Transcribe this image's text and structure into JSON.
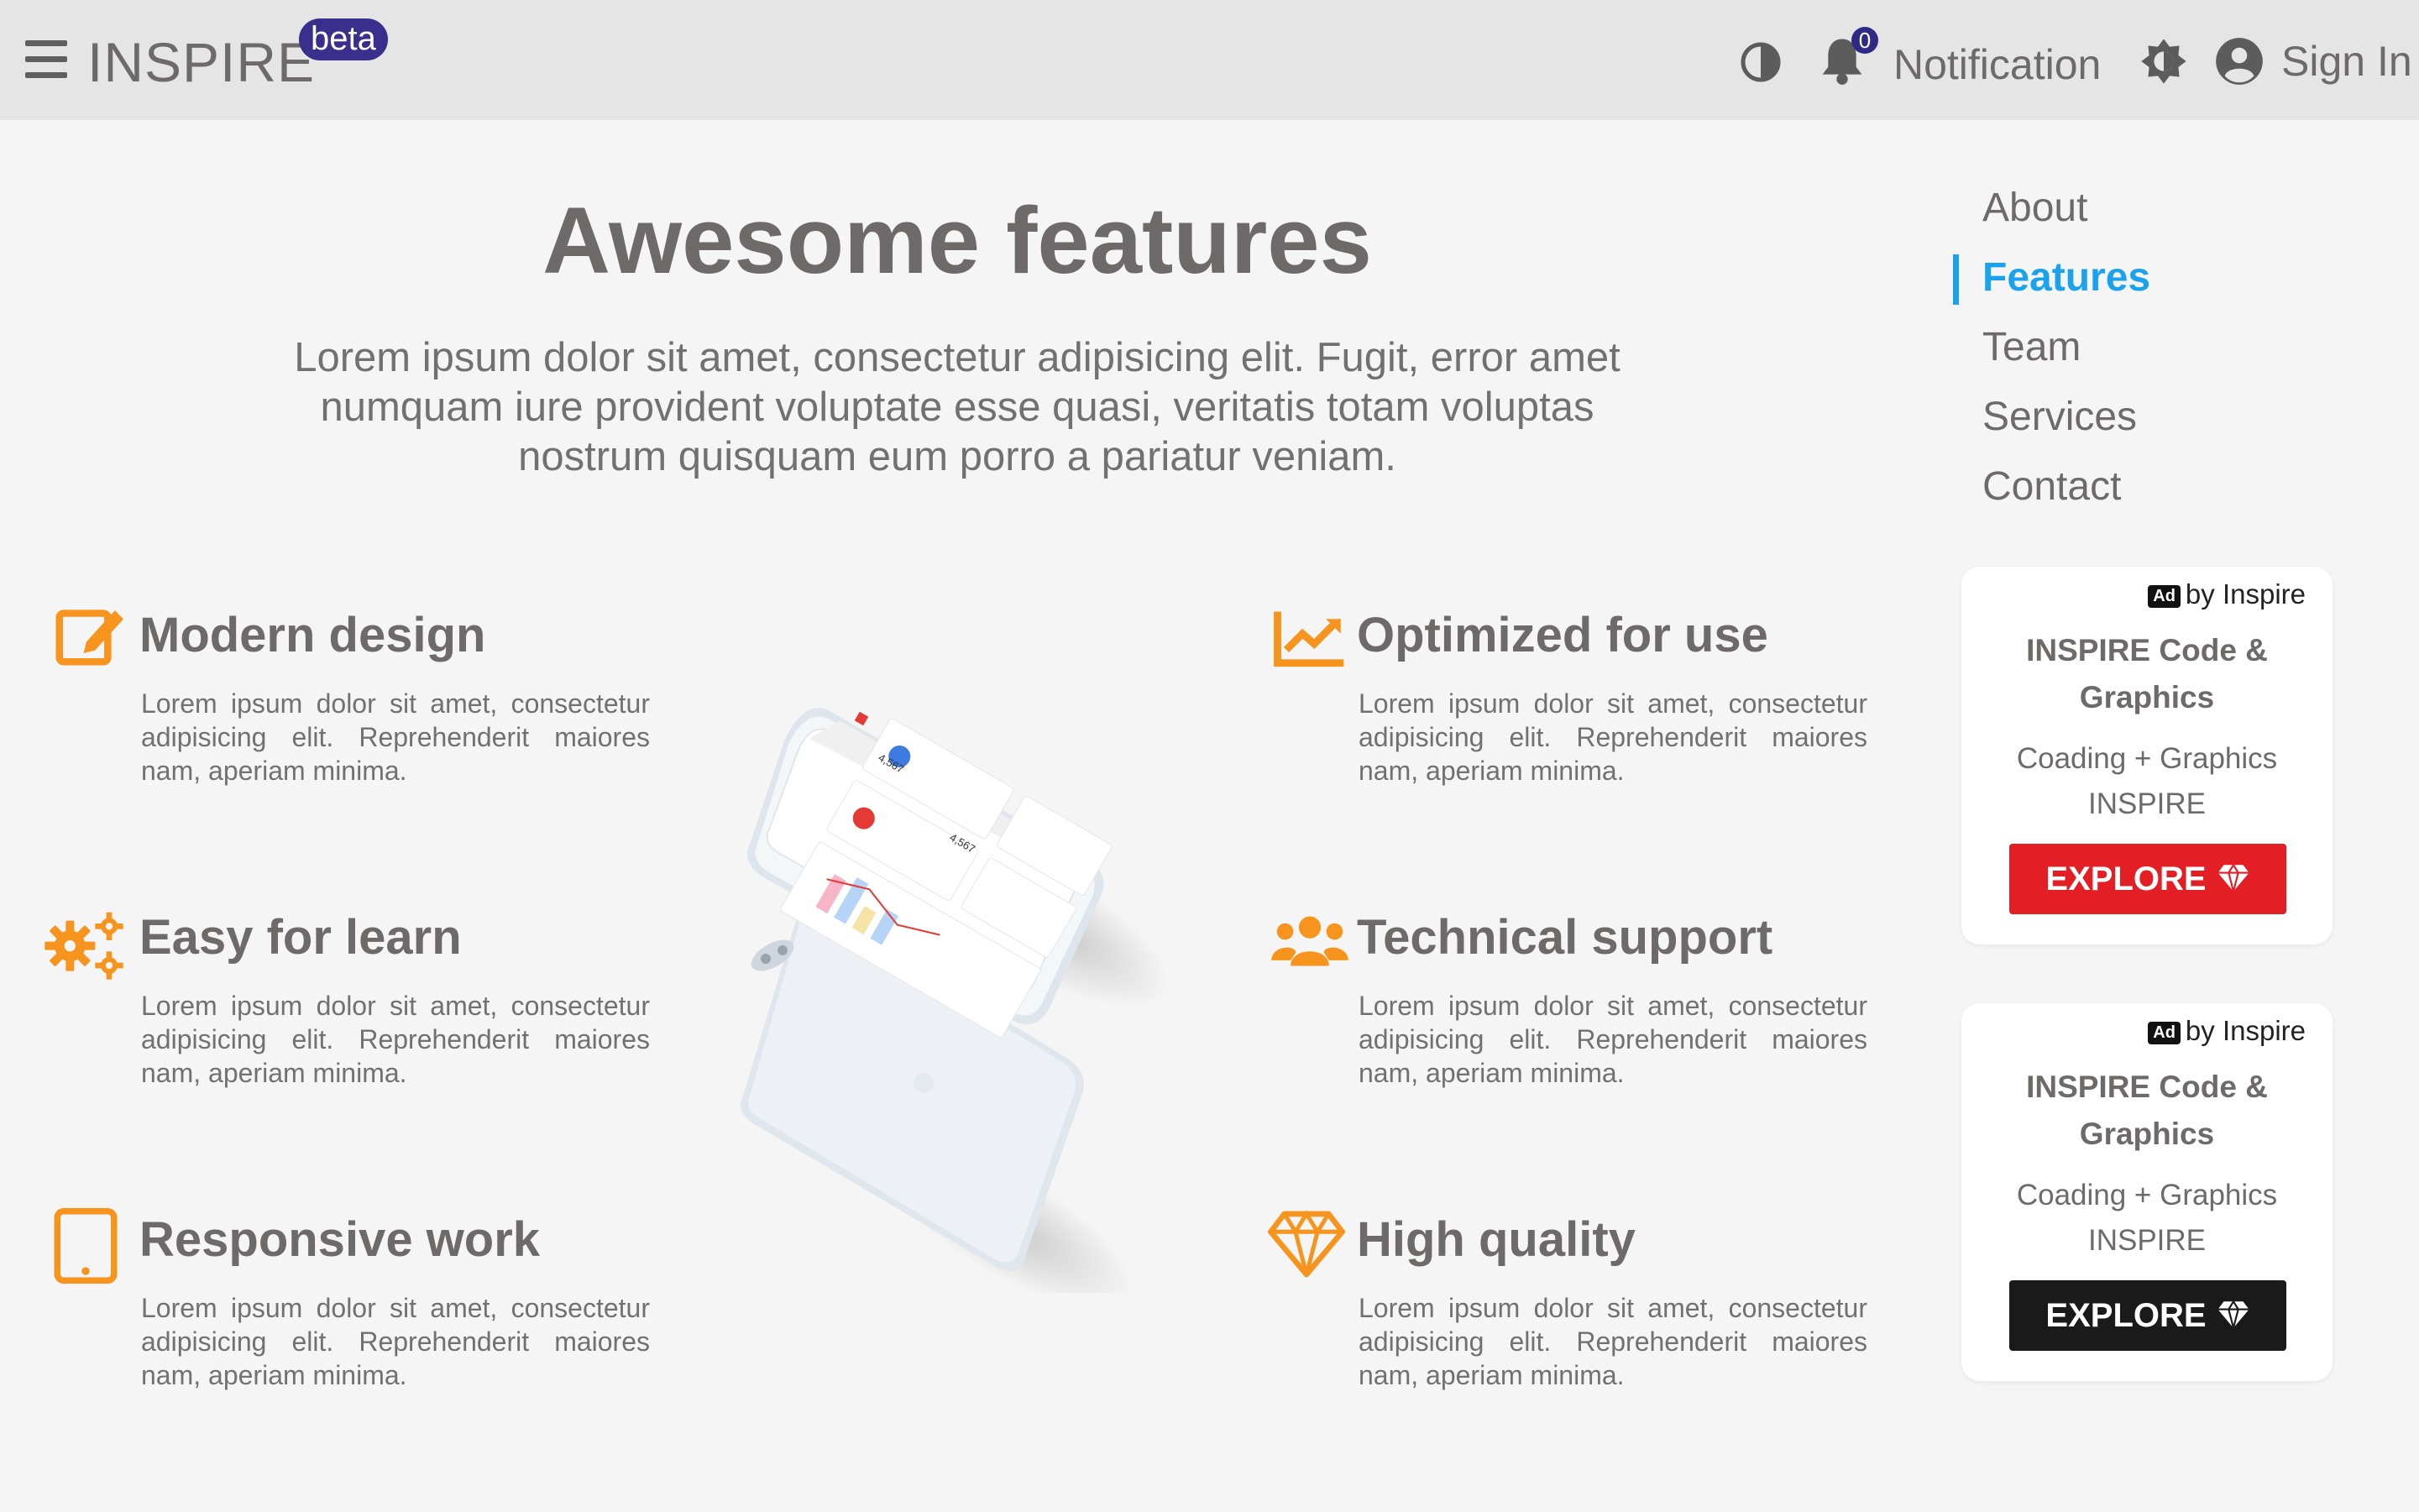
{
  "header": {
    "brand": "INSPIRE",
    "badge": "beta",
    "notification_count": "0",
    "notification_label": "Notification",
    "signin_label": "Sign In"
  },
  "hero": {
    "title": "Awesome features",
    "description_lines": [
      "Lorem ipsum dolor sit amet, consectetur adipisicing elit. Fugit, error amet",
      "numquam iure provident voluptate esse quasi, veritatis totam voluptas",
      "nostrum quisquam eum porro a pariatur veniam."
    ]
  },
  "side_nav": {
    "items": [
      "About",
      "Features",
      "Team",
      "Services",
      "Contact"
    ],
    "active": "Features"
  },
  "features": [
    {
      "title": "Modern design",
      "icon": "edit-icon",
      "text": "Lorem ipsum dolor sit amet, consectetur adipisicing elit. Reprehenderit maiores nam, aperiam minima."
    },
    {
      "title": "Easy for learn",
      "icon": "gears-icon",
      "text": "Lorem ipsum dolor sit amet, consectetur adipisicing elit. Reprehenderit maiores nam, aperiam minima."
    },
    {
      "title": "Responsive work",
      "icon": "tablet-icon",
      "text": "Lorem ipsum dolor sit amet, consectetur adipisicing elit. Reprehenderit maiores nam, aperiam minima."
    },
    {
      "title": "Optimized for use",
      "icon": "line-chart-icon",
      "text": "Lorem ipsum dolor sit amet, consectetur adipisicing elit. Reprehenderit maiores nam, aperiam minima."
    },
    {
      "title": "Technical support",
      "icon": "users-icon",
      "text": "Lorem ipsum dolor sit amet, consectetur adipisicing elit. Reprehenderit maiores nam, aperiam minima."
    },
    {
      "title": "High quality",
      "icon": "diamond-icon",
      "text": "Lorem ipsum dolor sit amet, consectetur adipisicing elit. Reprehenderit maiores nam, aperiam minima."
    }
  ],
  "ads": [
    {
      "tag": "Ad",
      "by": "by Inspire",
      "title_lines": [
        "INSPIRE Code &",
        "Graphics"
      ],
      "sub_lines": [
        "Coading + Graphics",
        "INSPIRE"
      ],
      "button": "EXPLORE",
      "button_color": "#e31e24"
    },
    {
      "tag": "Ad",
      "by": "by Inspire",
      "title_lines": [
        "INSPIRE Code &",
        "Graphics"
      ],
      "sub_lines": [
        "Coading + Graphics",
        "INSPIRE"
      ],
      "button": "EXPLORE",
      "button_color": "#1a1a1a"
    }
  ],
  "colors": {
    "accent": "#1aa3ec",
    "icon_orange": "#f7941d",
    "badge": "#3b2f8e",
    "topbar": "#e5e5e5",
    "background": "#f5f5f5"
  },
  "phone_screen": {
    "stat_1": "4,567",
    "stat_2": "4,567"
  }
}
